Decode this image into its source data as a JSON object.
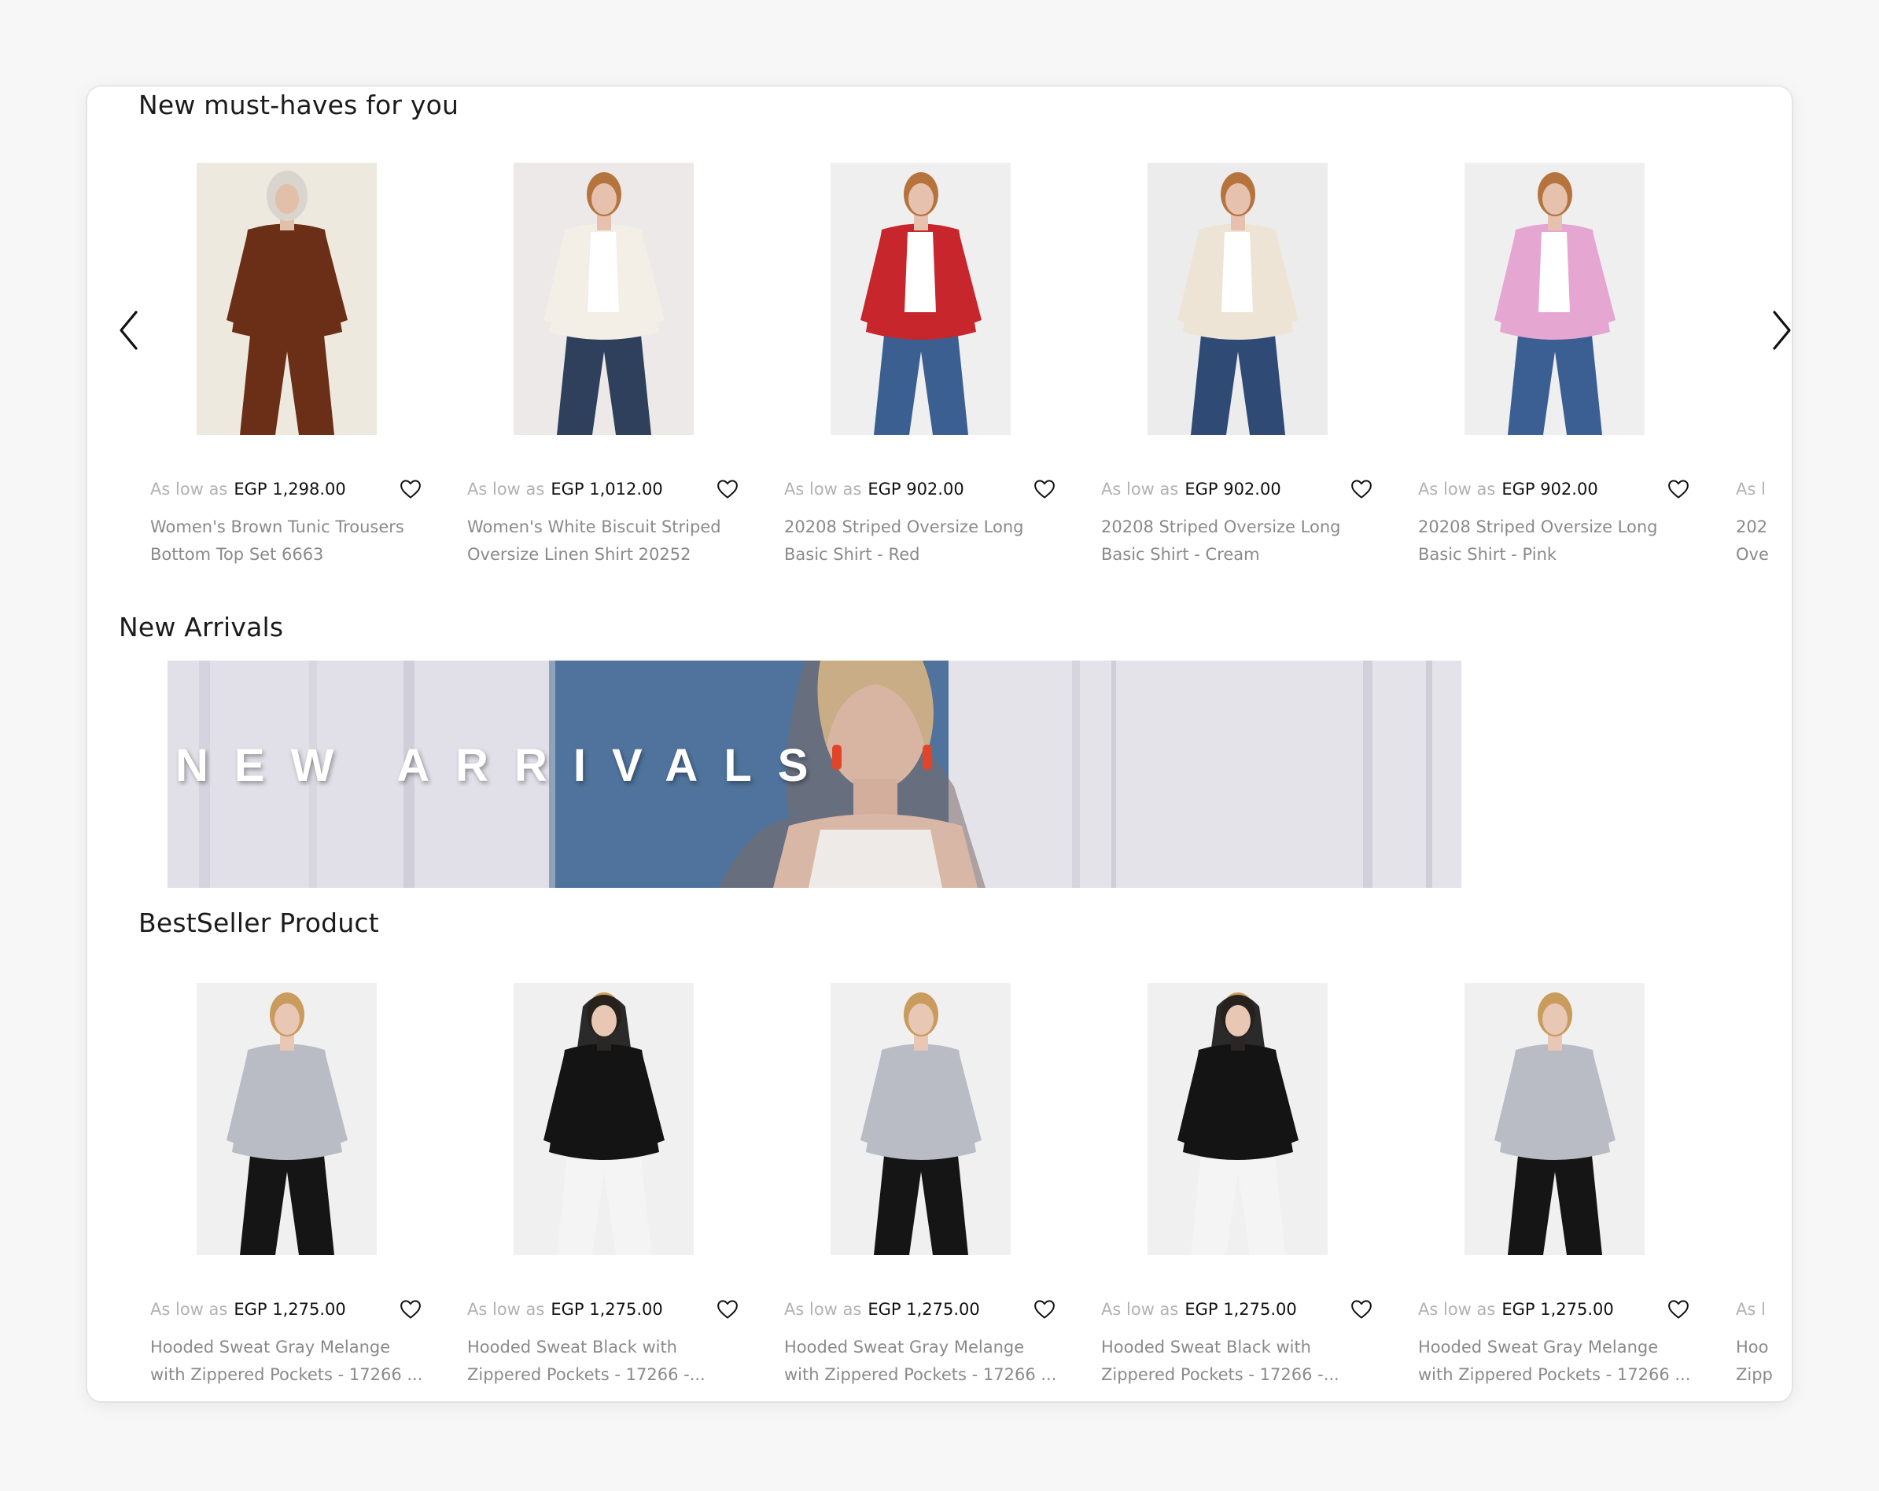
{
  "sections": {
    "must_haves": {
      "title": "New must-haves for you",
      "prev_label": "Previous",
      "next_label": "Next",
      "products": [
        {
          "price_prefix": "As low as",
          "price": "EGP 1,298.00",
          "name": "Women's Brown Tunic Trousers\nBottom Top Set 6663",
          "image": "brown-tunic-set"
        },
        {
          "price_prefix": "As low as",
          "price": "EGP 1,012.00",
          "name": "Women's White Biscuit Striped\nOversize Linen Shirt 20252",
          "image": "white-striped-shirt"
        },
        {
          "price_prefix": "As low as",
          "price": "EGP 902.00",
          "name": "20208 Striped Oversize Long\nBasic Shirt - Red",
          "image": "red-shirt"
        },
        {
          "price_prefix": "As low as",
          "price": "EGP 902.00",
          "name": "20208 Striped Oversize Long\nBasic Shirt - Cream",
          "image": "cream-shirt"
        },
        {
          "price_prefix": "As low as",
          "price": "EGP 902.00",
          "name": "20208 Striped Oversize Long\nBasic Shirt - Pink",
          "image": "pink-shirt"
        }
      ],
      "partial": {
        "price_prefix": "As l",
        "name_line1": "202",
        "name_line2": "Ove"
      }
    },
    "new_arrivals": {
      "title": "New Arrivals",
      "banner_text": "NEW ARRIVALS"
    },
    "bestseller": {
      "title": "BestSeller Product",
      "products": [
        {
          "price_prefix": "As low as",
          "price": "EGP 1,275.00",
          "name": "Hooded Sweat Gray Melange\nwith Zippered Pockets - 17266 ...",
          "image": "gray-hoodie"
        },
        {
          "price_prefix": "As low as",
          "price": "EGP 1,275.00",
          "name": "Hooded Sweat Black with\nZippered Pockets - 17266 -...",
          "image": "black-hoodie"
        },
        {
          "price_prefix": "As low as",
          "price": "EGP 1,275.00",
          "name": "Hooded Sweat Gray Melange\nwith Zippered Pockets - 17266 ...",
          "image": "gray-hoodie"
        },
        {
          "price_prefix": "As low as",
          "price": "EGP 1,275.00",
          "name": "Hooded Sweat Black with\nZippered Pockets - 17266 -...",
          "image": "black-hoodie"
        },
        {
          "price_prefix": "As low as",
          "price": "EGP 1,275.00",
          "name": "Hooded Sweat Gray Melange\nwith Zippered Pockets - 17266 ...",
          "image": "gray-hoodie"
        }
      ],
      "partial": {
        "price_prefix": "As l",
        "name_line1": "Hoo",
        "name_line2": "Zipp"
      }
    }
  },
  "colors": {
    "page_bg": "#f7f7f7",
    "card_bg": "#ffffff",
    "title": "#1b1b1b",
    "muted": "#b2b2b2",
    "name": "#8a8a8a",
    "price": "#111111"
  }
}
